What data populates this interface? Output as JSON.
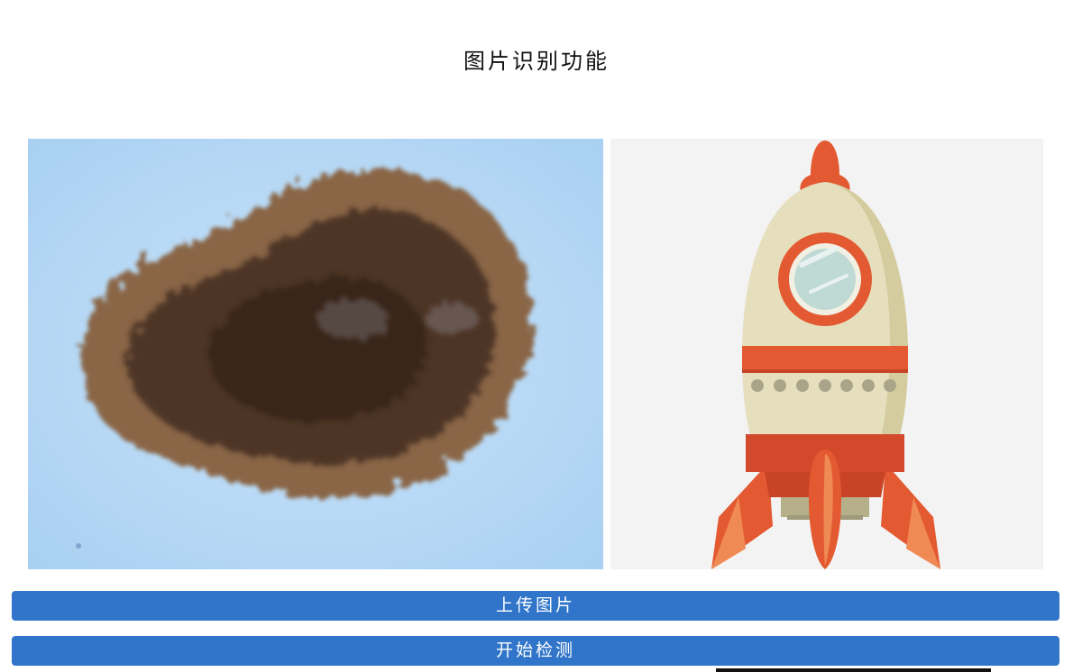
{
  "page": {
    "title": "图片识别功能"
  },
  "images": {
    "left": {
      "subject": "dermoscopy-lesion"
    },
    "right": {
      "subject": "rocket-illustration"
    }
  },
  "buttons": {
    "upload_label": "上传图片",
    "detect_label": "开始检测"
  },
  "colors": {
    "button_bg": "#3075c9",
    "button_text": "#ffffff",
    "rocket_red": "#e35a32",
    "rocket_body": "#e6dfbd"
  }
}
